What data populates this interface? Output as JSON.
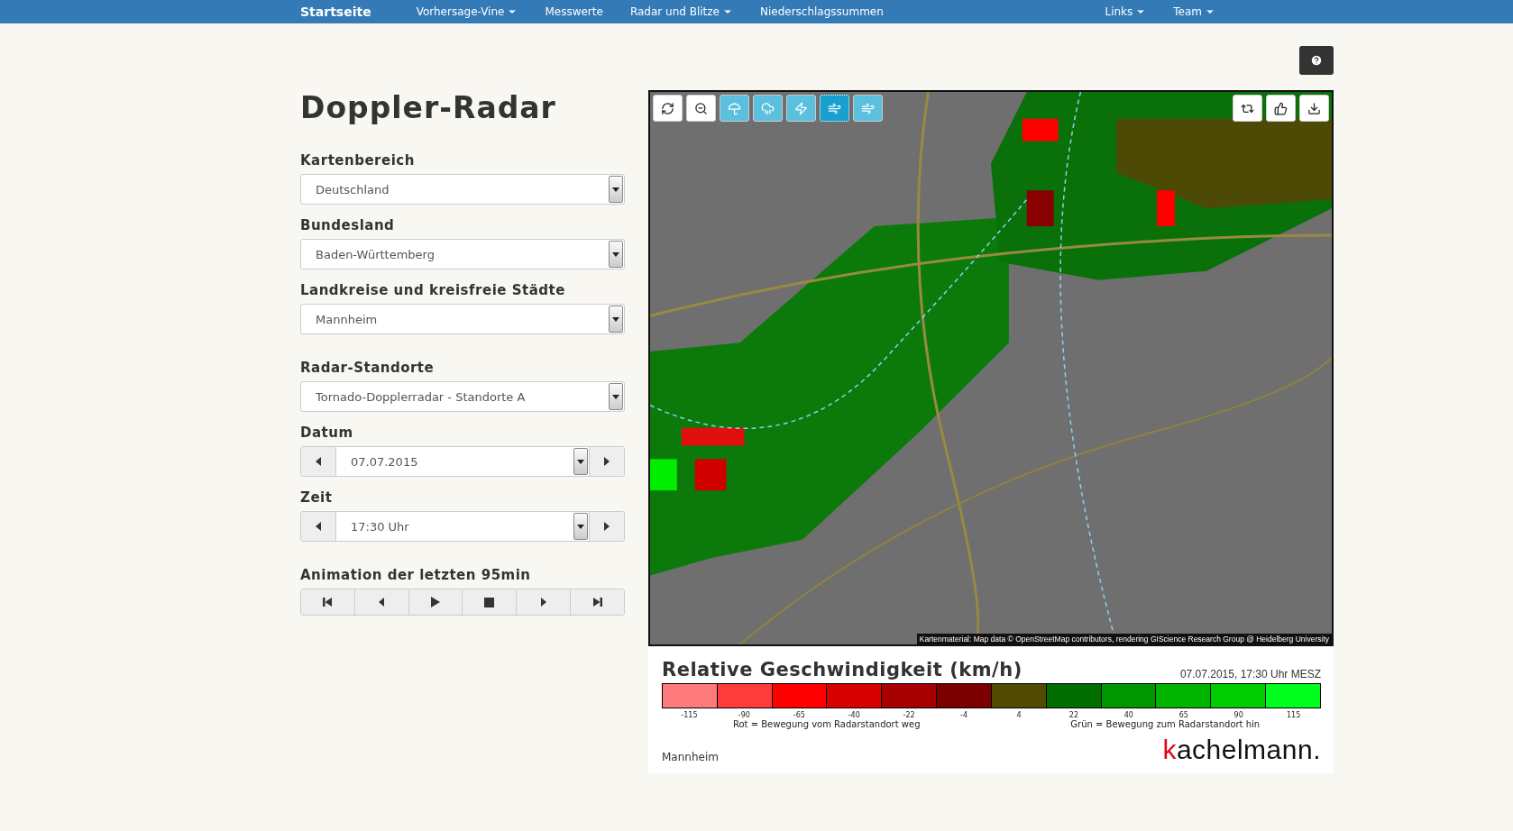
{
  "nav": {
    "brand": "Startseite",
    "items": [
      {
        "label": "Vorhersage-Vine",
        "dropdown": true
      },
      {
        "label": "Messwerte",
        "dropdown": false
      },
      {
        "label": "Radar und Blitze",
        "dropdown": true
      },
      {
        "label": "Niederschlagssummen",
        "dropdown": false
      }
    ],
    "right_items": [
      {
        "label": "Links",
        "dropdown": true
      },
      {
        "label": "Team",
        "dropdown": true
      }
    ]
  },
  "title": "Doppler-Radar",
  "selects": [
    {
      "label": "Kartenbereich",
      "value": "Deutschland"
    },
    {
      "label": "Bundesland",
      "value": "Baden-Württemberg"
    },
    {
      "label": "Landkreise und kreisfreie Städte",
      "value": "Mannheim"
    }
  ],
  "radar_select": {
    "label": "Radar-Standorte",
    "value": "Tornado-Dopplerradar - Standorte A"
  },
  "date": {
    "label": "Datum",
    "value": "07.07.2015"
  },
  "time": {
    "label": "Zeit",
    "value": "17:30 Uhr"
  },
  "animation": {
    "label": "Animation der letzten 95min"
  },
  "map_tools": [
    {
      "kind": "refresh",
      "selected": false
    },
    {
      "kind": "zoom-out",
      "selected": false
    },
    {
      "kind": "umbrella",
      "selected": false
    },
    {
      "kind": "rain",
      "selected": false
    },
    {
      "kind": "lightning",
      "selected": false
    },
    {
      "kind": "wind",
      "selected": true
    },
    {
      "kind": "wind2",
      "selected": false
    }
  ],
  "map_actions": [
    {
      "kind": "repeat"
    },
    {
      "kind": "like"
    },
    {
      "kind": "download"
    }
  ],
  "map": {
    "kind": "picture",
    "attribution": "Kartenmaterial: Map data © OpenStreetMap contributors, rendering GIScience Research Group @ Heidelberg University"
  },
  "legend": {
    "title": "Relative Geschwindigkeit (km/h)",
    "timestamp": "07.07.2015, 17:30 Uhr MESZ",
    "steps": [
      {
        "label": "-115",
        "color": "#ff7a7a"
      },
      {
        "label": "-90",
        "color": "#ff3c3c"
      },
      {
        "label": "-65",
        "color": "#ff0000"
      },
      {
        "label": "-40",
        "color": "#d90000"
      },
      {
        "label": "-22",
        "color": "#a80000"
      },
      {
        "label": "-4",
        "color": "#7d0000"
      },
      {
        "label": "4",
        "color": "#524a00"
      },
      {
        "label": "22",
        "color": "#006e00"
      },
      {
        "label": "40",
        "color": "#009600"
      },
      {
        "label": "65",
        "color": "#00b400"
      },
      {
        "label": "90",
        "color": "#00cc00"
      },
      {
        "label": "115",
        "color": "#00ff1e"
      }
    ],
    "note_left": "Rot = Bewegung vom Radarstandort weg",
    "note_right": "Grün = Bewegung zum Radarstandort hin",
    "place": "Mannheim",
    "brand": "kachelmann."
  }
}
